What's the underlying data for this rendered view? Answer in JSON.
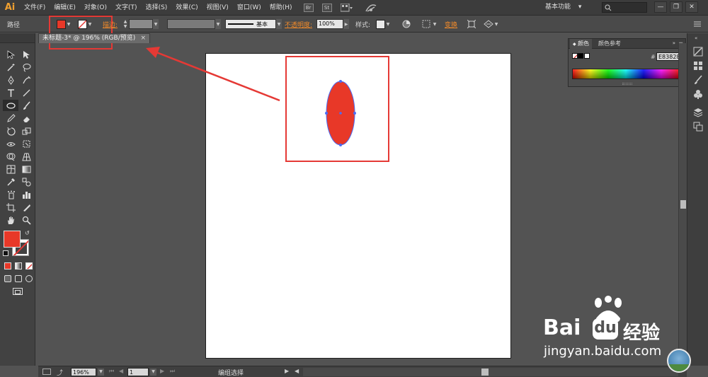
{
  "app": {
    "logo": "Ai"
  },
  "menu": [
    "文件(F)",
    "编辑(E)",
    "对象(O)",
    "文字(T)",
    "选择(S)",
    "效果(C)",
    "视图(V)",
    "窗口(W)",
    "帮助(H)"
  ],
  "menu_icons": {
    "br": "Br",
    "st": "St"
  },
  "workspace": {
    "label": "基本功能",
    "arrow": "▾"
  },
  "search": {
    "placeholder": "",
    "icon": "search-icon"
  },
  "controlbar": {
    "selection_label": "路径",
    "stroke_label": "描边:",
    "stroke_style": "基本",
    "opacity_label": "不透明度:",
    "opacity_value": "100%",
    "style_label": "样式:",
    "transform_label": "变换"
  },
  "document": {
    "tab_title": "未标题-3* @ 196% (RGB/预览)",
    "close": "×"
  },
  "color_panel": {
    "tabs": [
      "颜色",
      "颜色参考"
    ],
    "hex_prefix": "#",
    "hex_value": "E83828"
  },
  "colors": {
    "fill": "#e83828",
    "shape": "#e83828",
    "annotation": "#e53935",
    "selection": "#4a6cf5"
  },
  "statusbar": {
    "zoom": "196%",
    "page": "1",
    "status_text": "编组选择"
  },
  "watermark": {
    "brand_left": "Bai",
    "brand_right": "经验",
    "url": "jingyan.baidu.com"
  }
}
